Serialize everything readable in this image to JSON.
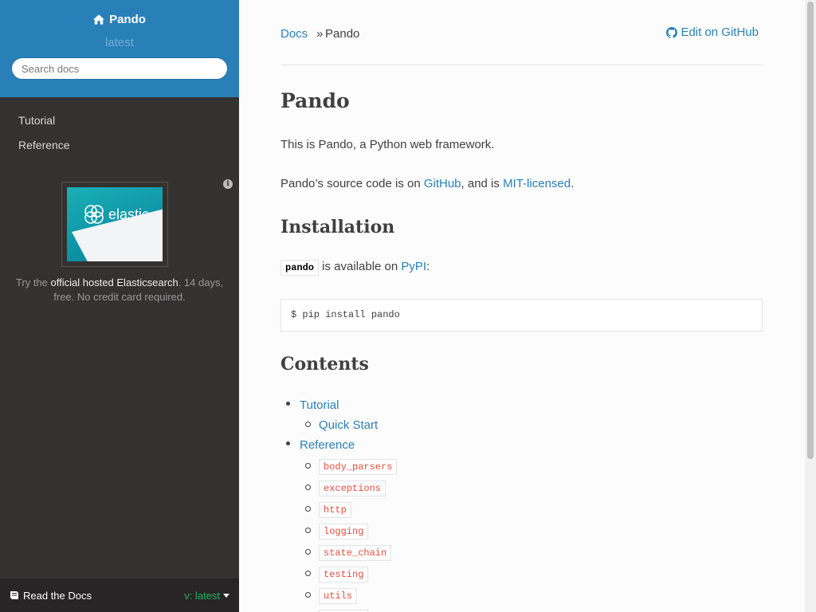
{
  "sidebar": {
    "project_name": "Pando",
    "version": "latest",
    "search_placeholder": "Search docs",
    "nav": [
      {
        "label": "Tutorial"
      },
      {
        "label": "Reference"
      }
    ],
    "ad": {
      "image_brand": "elastic",
      "text_prefix": "Try the ",
      "link_text": "official hosted Elasticsearch",
      "text_suffix": ". 14 days, free. No credit card required."
    },
    "footer": {
      "rtd_label": "Read the Docs",
      "version_label": "v: latest"
    }
  },
  "breadcrumb": {
    "root": "Docs",
    "separator": "»",
    "current": "Pando",
    "edit_link": "Edit on GitHub"
  },
  "content": {
    "title": "Pando",
    "intro": "This is Pando, a Python web framework.",
    "source": {
      "prefix": "Pando’s source code is on ",
      "github": "GitHub",
      "middle": ", and is ",
      "license": "MIT-licensed",
      "suffix": "."
    },
    "installation": {
      "heading": "Installation",
      "package": "pando",
      "available_text": " is available on ",
      "pypi": "PyPI",
      "colon": ":",
      "command": "$ pip install pando"
    },
    "contents": {
      "heading": "Contents",
      "tutorial": "Tutorial",
      "quick_start": "Quick Start",
      "reference": "Reference",
      "modules": [
        "body_parsers",
        "exceptions",
        "http",
        "logging",
        "state_chain",
        "testing",
        "utils",
        "website"
      ]
    }
  }
}
